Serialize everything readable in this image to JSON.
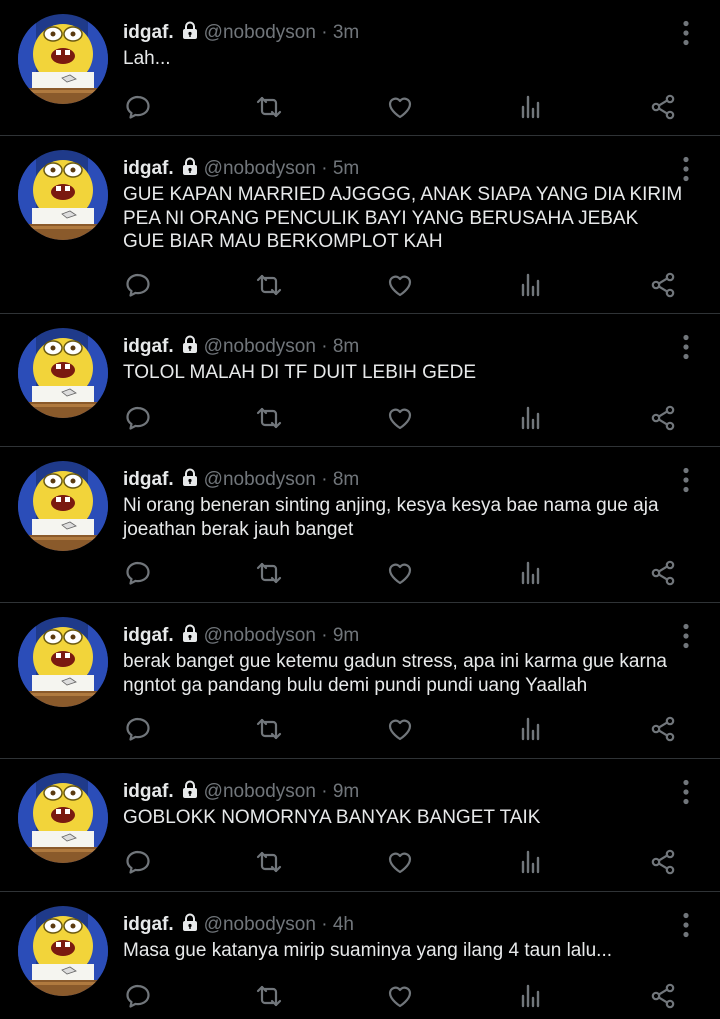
{
  "icons": {
    "lock": "lock-icon",
    "more": "more-vertical-icon",
    "reply": "reply-icon",
    "retweet": "retweet-icon",
    "like": "heart-icon",
    "views": "analytics-icon",
    "share": "share-icon"
  },
  "colors": {
    "background": "#000000",
    "text": "#e7e9ea",
    "muted": "#71767b",
    "divider": "#2f3336"
  },
  "tweets": [
    {
      "display_name": "idgaf.",
      "handle": "@nobodyson",
      "separator": "·",
      "time": "3m",
      "text": "Lah..."
    },
    {
      "display_name": "idgaf.",
      "handle": "@nobodyson",
      "separator": "·",
      "time": "5m",
      "text": "GUE KAPAN MARRIED AJGGGG, ANAK SIAPA YANG DIA KIRIM PEA NI ORANG PENCULIK BAYI YANG BERUSAHA JEBAK GUE BIAR MAU BERKOMPLOT KAH"
    },
    {
      "display_name": "idgaf.",
      "handle": "@nobodyson",
      "separator": "·",
      "time": "8m",
      "text": "TOLOL MALAH DI TF DUIT LEBIH GEDE"
    },
    {
      "display_name": "idgaf.",
      "handle": "@nobodyson",
      "separator": "·",
      "time": "8m",
      "text": "Ni orang beneran sinting anjing, kesya kesya bae nama gue aja joeathan berak jauh banget"
    },
    {
      "display_name": "idgaf.",
      "handle": "@nobodyson",
      "separator": "·",
      "time": "9m",
      "text": "berak banget gue ketemu gadun stress, apa ini karma gue karna ngntot ga pandang bulu demi pundi pundi uang Yaallah"
    },
    {
      "display_name": "idgaf.",
      "handle": "@nobodyson",
      "separator": "·",
      "time": "9m",
      "text": "GOBLOKK NOMORNYA BANYAK BANGET TAIK"
    },
    {
      "display_name": "idgaf.",
      "handle": "@nobodyson",
      "separator": "·",
      "time": "4h",
      "text": "Masa gue katanya mirip suaminya yang ilang 4 taun lalu..."
    }
  ]
}
